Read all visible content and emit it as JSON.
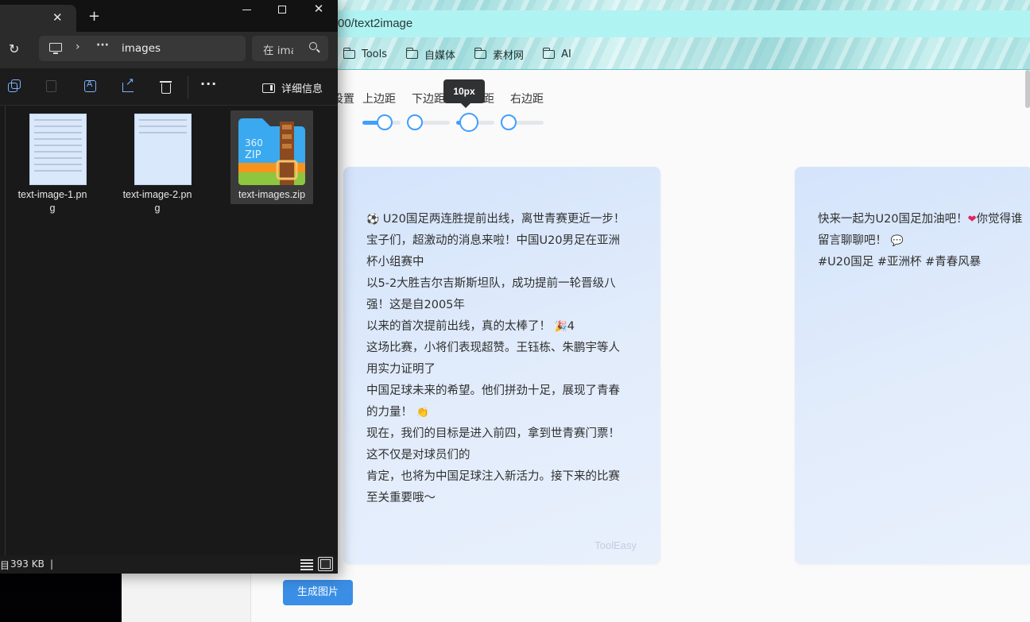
{
  "browser": {
    "url_fragment": "00/text2image",
    "bookmarks": [
      {
        "label": "Tools"
      },
      {
        "label": "自媒体"
      },
      {
        "label": "素材网"
      },
      {
        "label": "AI"
      }
    ]
  },
  "settings": {
    "partial_label": "设置",
    "top_margin_label": "上边距",
    "bottom_margin_label": "下边距",
    "left_margin_partial": "距",
    "right_margin_label": "右边距",
    "tooltip": "10px",
    "top_margin_fraction": 0.5,
    "bottom_margin_fraction": 0.0,
    "left_margin_fraction": 0.25,
    "right_margin_fraction": 0.0
  },
  "card1": {
    "lines": [
      "U20国足两连胜提前出线，离世青赛更近一步！",
      "宝子们，超激动的消息来啦！中国U20男足在亚洲",
      "杯小组赛中",
      "以5-2大胜吉尔吉斯斯坦队，成功提前一轮晋级八",
      "强！这是自2005年",
      "以来的首次提前出线，真的太棒了！",
      "这场比赛，小将们表现超赞。王钰栋、朱鹏宇等人",
      "用实力证明了",
      "中国足球未来的希望。他们拼劲十足，展现了青春",
      "的力量！",
      "现在，我们的目标是进入前四，拿到世青赛门票！",
      "这不仅是对球员们的",
      "肯定，也将为中国足球注入新活力。接下来的比赛",
      "至关重要哦～"
    ],
    "line6_suffix": "4",
    "watermark": "ToolEasy"
  },
  "card2": {
    "line1": "快来一起为U20国足加油吧！",
    "line1_suffix": "你觉得谁",
    "line2": "留言聊聊吧！",
    "line3": "#U20国足 #亚洲杯 #青春风暴"
  },
  "generate_button": "生成图片",
  "explorer": {
    "tab_close": "✕",
    "new_tab": "+",
    "address": "images",
    "search_placeholder": "在 images 中搜索",
    "details_label": "详细信息",
    "more": "···",
    "files": [
      {
        "name": "text-image-1.png",
        "line1": "text-image-1.pn",
        "line2": "g"
      },
      {
        "name": "text-image-2.png",
        "line1": "text-image-2.pn",
        "line2": "g"
      },
      {
        "name": "text-images.zip",
        "line1": "text-images.zip",
        "line2": ""
      }
    ],
    "zip_brand_top": "360",
    "zip_brand_bottom": "ZIP",
    "status_partial": "目",
    "status_size": "393 KB",
    "status_sep": "|"
  },
  "colors": {
    "accent": "#409eff",
    "button": "#3a8ee6",
    "explorer_bg": "#1c1c1c"
  }
}
